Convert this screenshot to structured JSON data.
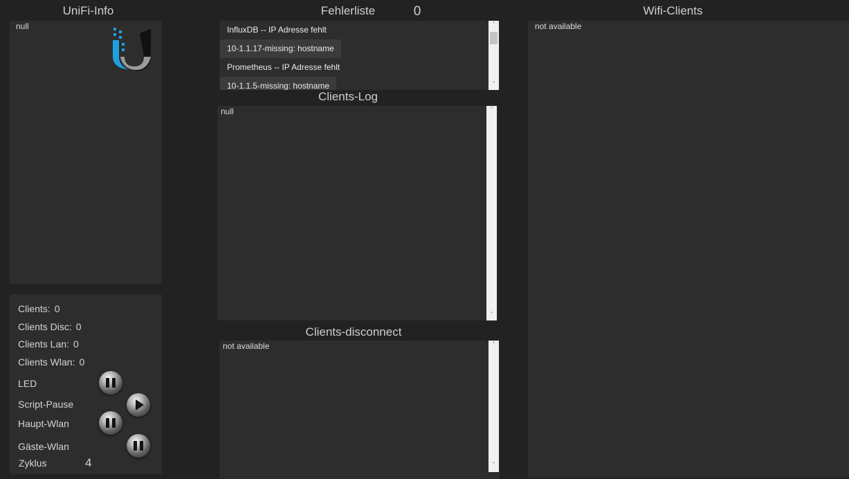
{
  "unifi": {
    "title": "UniFi-Info",
    "info_text": "null",
    "logo_icon": "ubiquiti-logo-icon",
    "brand_blue": "#1fa0e0"
  },
  "stats": {
    "clients_label": "Clients:",
    "clients_value": "0",
    "clients_disc_label": "Clients Disc:",
    "clients_disc_value": "0",
    "clients_lan_label": "Clients Lan:",
    "clients_lan_value": "0",
    "clients_wlan_label": "Clients Wlan:",
    "clients_wlan_value": "0",
    "led_label": "LED",
    "script_pause_label": "Script-Pause",
    "haupt_wlan_label": "Haupt-Wlan",
    "gaeste_wlan_label": "Gäste-Wlan",
    "zyklus_label": "Zyklus",
    "zyklus_value": "4"
  },
  "fehlerliste": {
    "title": "Fehlerliste",
    "count": "0",
    "items": [
      "InfluxDB -- IP Adresse fehlt",
      "10-1.1.17-missing: hostname",
      "Prometheus -- IP Adresse fehlt",
      "10-1.1.5-missing: hostname"
    ]
  },
  "clients_log": {
    "title": "Clients-Log",
    "text": "null"
  },
  "clients_disconnect": {
    "title": "Clients-disconnect",
    "text": "not available"
  },
  "wifi_clients": {
    "title": "Wifi-Clients",
    "text": "not available"
  }
}
